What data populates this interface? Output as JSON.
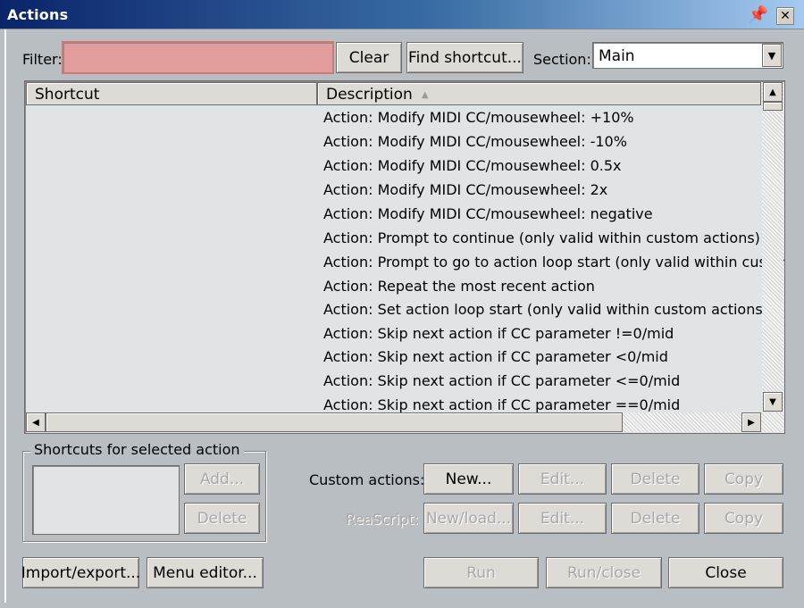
{
  "window": {
    "title": "Actions",
    "pin_icon": "pin-icon",
    "close_icon": "close-icon"
  },
  "filter": {
    "label": "Filter:",
    "value": "",
    "clear_label": "Clear",
    "find_shortcut_label": "Find shortcut..."
  },
  "section": {
    "label": "Section:",
    "selected": "Main"
  },
  "table": {
    "columns": [
      "Shortcut",
      "Description"
    ],
    "sort_column": "Description",
    "sort_direction": "ascending",
    "rows": [
      {
        "shortcut": "",
        "description": "Action: Modify MIDI CC/mousewheel: +10%"
      },
      {
        "shortcut": "",
        "description": "Action: Modify MIDI CC/mousewheel: -10%"
      },
      {
        "shortcut": "",
        "description": "Action: Modify MIDI CC/mousewheel: 0.5x"
      },
      {
        "shortcut": "",
        "description": "Action: Modify MIDI CC/mousewheel: 2x"
      },
      {
        "shortcut": "",
        "description": "Action: Modify MIDI CC/mousewheel: negative"
      },
      {
        "shortcut": "",
        "description": "Action: Prompt to continue (only valid within custom actions)"
      },
      {
        "shortcut": "",
        "description": "Action: Prompt to go to action loop start (only valid within custom a"
      },
      {
        "shortcut": "",
        "description": "Action: Repeat the most recent action"
      },
      {
        "shortcut": "",
        "description": "Action: Set action loop start (only valid within custom actions)"
      },
      {
        "shortcut": "",
        "description": "Action: Skip next action if CC parameter !=0/mid"
      },
      {
        "shortcut": "",
        "description": "Action: Skip next action if CC parameter <0/mid"
      },
      {
        "shortcut": "",
        "description": "Action: Skip next action if CC parameter <=0/mid"
      },
      {
        "shortcut": "",
        "description": "Action: Skip next action if CC parameter ==0/mid"
      }
    ]
  },
  "shortcuts_group": {
    "title": "Shortcuts for selected action",
    "add_label": "Add...",
    "delete_label": "Delete"
  },
  "custom_actions": {
    "label": "Custom actions:",
    "new_label": "New...",
    "edit_label": "Edit...",
    "delete_label": "Delete",
    "copy_label": "Copy"
  },
  "reascript": {
    "label": "ReaScript:",
    "new_load_label": "New/load...",
    "edit_label": "Edit...",
    "delete_label": "Delete",
    "copy_label": "Copy"
  },
  "footer": {
    "import_export_label": "Import/export...",
    "menu_editor_label": "Menu editor...",
    "run_label": "Run",
    "run_close_label": "Run/close",
    "close_label": "Close"
  }
}
